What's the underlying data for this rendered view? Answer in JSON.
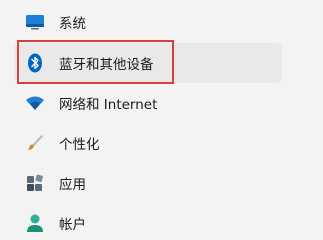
{
  "sidebar": {
    "items": [
      {
        "label": "系统",
        "icon": "monitor-icon"
      },
      {
        "label": "蓝牙和其他设备",
        "icon": "bluetooth-icon",
        "selected": true
      },
      {
        "label": "网络和 Internet",
        "icon": "wifi-icon"
      },
      {
        "label": "个性化",
        "icon": "brush-icon"
      },
      {
        "label": "应用",
        "icon": "apps-icon"
      },
      {
        "label": "帐户",
        "icon": "account-icon"
      }
    ]
  },
  "colors": {
    "accent": "#0067c0",
    "selected_bg": "#e9e9e9",
    "highlight": "#d9403a"
  }
}
